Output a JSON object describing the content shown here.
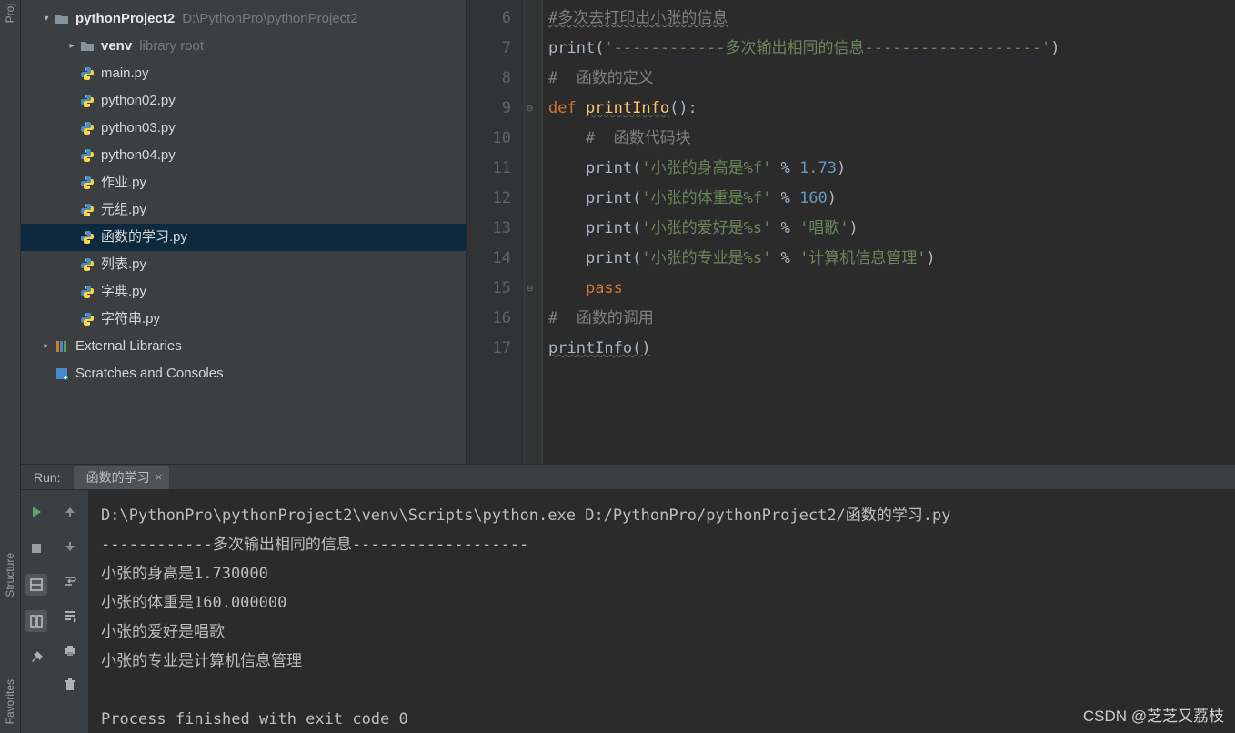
{
  "leftStrip": {
    "project": "Proj",
    "structure": "Structure",
    "favorites": "Favorites"
  },
  "tree": {
    "root": {
      "name": "pythonProject2",
      "path": "D:\\PythonPro\\pythonProject2"
    },
    "venv": {
      "name": "venv",
      "hint": "library root"
    },
    "files": [
      "main.py",
      "python02.py",
      "python03.py",
      "python04.py",
      "作业.py",
      "元组.py",
      "函数的学习.py",
      "列表.py",
      "字典.py",
      "字符串.py"
    ],
    "external": "External Libraries",
    "scratches": "Scratches and Consoles",
    "selected": "函数的学习.py"
  },
  "editor": {
    "startLine": 6,
    "lines": [
      {
        "n": 6,
        "seg": [
          {
            "t": "#多次去打印出小张的信息",
            "c": "c-comment wavy"
          }
        ]
      },
      {
        "n": 7,
        "seg": [
          {
            "t": "print",
            "c": "c-op"
          },
          {
            "t": "(",
            "c": "c-op"
          },
          {
            "t": "'------------多次输出相同的信息-------------------'",
            "c": "c-str"
          },
          {
            "t": ")",
            "c": "c-op"
          }
        ]
      },
      {
        "n": 8,
        "seg": [
          {
            "t": "#  函数的定义",
            "c": "c-comment"
          }
        ]
      },
      {
        "n": 9,
        "seg": [
          {
            "t": "def ",
            "c": "c-kw"
          },
          {
            "t": "printInfo",
            "c": "c-fn wavy2"
          },
          {
            "t": "():",
            "c": "c-op"
          }
        ]
      },
      {
        "n": 10,
        "indent": 1,
        "seg": [
          {
            "t": "#  函数代码块",
            "c": "c-comment"
          }
        ]
      },
      {
        "n": 11,
        "indent": 1,
        "seg": [
          {
            "t": "print",
            "c": "c-op"
          },
          {
            "t": "(",
            "c": "c-op"
          },
          {
            "t": "'小张的身高是%f'",
            "c": "c-str"
          },
          {
            "t": " % ",
            "c": "c-op"
          },
          {
            "t": "1.73",
            "c": "c-num"
          },
          {
            "t": ")",
            "c": "c-op"
          }
        ]
      },
      {
        "n": 12,
        "indent": 1,
        "seg": [
          {
            "t": "print",
            "c": "c-op"
          },
          {
            "t": "(",
            "c": "c-op"
          },
          {
            "t": "'小张的体重是%f'",
            "c": "c-str"
          },
          {
            "t": " % ",
            "c": "c-op"
          },
          {
            "t": "160",
            "c": "c-num"
          },
          {
            "t": ")",
            "c": "c-op"
          }
        ]
      },
      {
        "n": 13,
        "indent": 1,
        "seg": [
          {
            "t": "print",
            "c": "c-op"
          },
          {
            "t": "(",
            "c": "c-op"
          },
          {
            "t": "'小张的爱好是%s'",
            "c": "c-str"
          },
          {
            "t": " % ",
            "c": "c-op"
          },
          {
            "t": "'唱歌'",
            "c": "c-str"
          },
          {
            "t": ")",
            "c": "c-op"
          }
        ]
      },
      {
        "n": 14,
        "indent": 1,
        "seg": [
          {
            "t": "print",
            "c": "c-op"
          },
          {
            "t": "(",
            "c": "c-op"
          },
          {
            "t": "'小张的专业是%s'",
            "c": "c-str"
          },
          {
            "t": " % ",
            "c": "c-op"
          },
          {
            "t": "'计算机信息管理'",
            "c": "c-str"
          },
          {
            "t": ")",
            "c": "c-op"
          }
        ]
      },
      {
        "n": 15,
        "indent": 1,
        "seg": [
          {
            "t": "pass",
            "c": "c-kw"
          }
        ]
      },
      {
        "n": 16,
        "seg": [
          {
            "t": "#  函数的调用",
            "c": "c-comment"
          }
        ]
      },
      {
        "n": 17,
        "seg": [
          {
            "t": "printInfo()",
            "c": "c-op wavy2"
          }
        ]
      }
    ]
  },
  "run": {
    "label": "Run:",
    "tabName": "函数的学习",
    "output": [
      "D:\\PythonPro\\pythonProject2\\venv\\Scripts\\python.exe D:/PythonPro/pythonProject2/函数的学习.py",
      "------------多次输出相同的信息-------------------",
      "小张的身高是1.730000",
      "小张的体重是160.000000",
      "小张的爱好是唱歌",
      "小张的专业是计算机信息管理",
      "",
      "Process finished with exit code 0"
    ]
  },
  "watermark": "CSDN @芝芝又荔枝"
}
